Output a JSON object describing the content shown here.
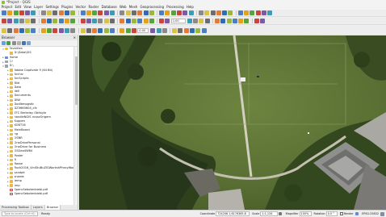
{
  "window": {
    "title": "*Project - QGIS"
  },
  "menu": [
    "Project",
    "Edit",
    "View",
    "Layer",
    "Settings",
    "Plugins",
    "Vector",
    "Raster",
    "Database",
    "Web",
    "Mesh",
    "Geoprocessing",
    "Processing",
    "Help"
  ],
  "browser": {
    "title": "Browser",
    "tree": [
      {
        "label": "Favorites",
        "icon": "star",
        "depth": 0,
        "arrow": "▾"
      },
      {
        "label": "D:\\Data\\GIS",
        "icon": "folder",
        "depth": 1,
        "arrow": ""
      },
      {
        "label": "Home",
        "icon": "home",
        "depth": 0,
        "arrow": "▸"
      },
      {
        "label": "C:\\",
        "icon": "drive",
        "depth": 0,
        "arrow": "▸"
      },
      {
        "label": "D:\\",
        "icon": "drive",
        "depth": 0,
        "arrow": "▾"
      },
      {
        "label": "Adobe Captivate 9 (64 Bit)",
        "icon": "folder",
        "depth": 1,
        "arrow": "▸"
      },
      {
        "label": "Archiv",
        "icon": "folder",
        "depth": 1,
        "arrow": "▸"
      },
      {
        "label": "ArcScripts",
        "icon": "folder",
        "depth": 1,
        "arrow": "▸"
      },
      {
        "label": "Bild",
        "icon": "folder",
        "depth": 1,
        "arrow": "▸"
      },
      {
        "label": "Data",
        "icon": "folder",
        "depth": 1,
        "arrow": "▸"
      },
      {
        "label": "dell",
        "icon": "folder",
        "depth": 1,
        "arrow": "▸"
      },
      {
        "label": "Documents",
        "icon": "folder",
        "depth": 1,
        "arrow": "▸"
      },
      {
        "label": "DNA",
        "icon": "folder",
        "depth": 1,
        "arrow": "▸"
      },
      {
        "label": "Dodlbmpgstb",
        "icon": "folder",
        "depth": 1,
        "arrow": "▸"
      },
      {
        "label": "DZ3660604_cfz",
        "icon": "folder",
        "depth": 1,
        "arrow": "▸"
      },
      {
        "label": "ETC Berkeley Obfstyle",
        "icon": "folder",
        "depth": 1,
        "arrow": "▸"
      },
      {
        "label": "handleNGIS ncsszOrigem",
        "icon": "folder",
        "depth": 1,
        "arrow": "▸"
      },
      {
        "label": "Kuppen",
        "icon": "folder",
        "depth": 1,
        "arrow": "▸"
      },
      {
        "label": "KOBT16",
        "icon": "folder",
        "depth": 1,
        "arrow": "▸"
      },
      {
        "label": "MeinBoard",
        "icon": "folder",
        "depth": 1,
        "arrow": "▸"
      },
      {
        "label": "ng",
        "icon": "folder",
        "depth": 1,
        "arrow": "▸"
      },
      {
        "label": "OSNR",
        "icon": "folder",
        "depth": 1,
        "arrow": "▸"
      },
      {
        "label": "OneDrivePersonal",
        "icon": "folder",
        "depth": 1,
        "arrow": "▸"
      },
      {
        "label": "OneDrive for Business",
        "icon": "folder",
        "depth": 1,
        "arrow": "▸"
      },
      {
        "label": "OSGeo4W64",
        "icon": "folder",
        "depth": 1,
        "arrow": "▸"
      },
      {
        "label": "Poster",
        "icon": "folder",
        "depth": 1,
        "arrow": "▸"
      },
      {
        "label": "R",
        "icon": "folder",
        "depth": 1,
        "arrow": "▸"
      },
      {
        "label": "Rasse",
        "icon": "folder",
        "depth": 1,
        "arrow": "▸"
      },
      {
        "label": "Ruck2016_ViniStuBuZIGWorkshPhecyWorn",
        "icon": "folder",
        "depth": 1,
        "arrow": "▸"
      },
      {
        "label": "sandpit",
        "icon": "folder",
        "depth": 1,
        "arrow": "▸"
      },
      {
        "label": "snarde",
        "icon": "folder",
        "depth": 1,
        "arrow": "▸"
      },
      {
        "label": "temp",
        "icon": "folder",
        "depth": 1,
        "arrow": "▸"
      },
      {
        "label": "tmp",
        "icon": "folder",
        "depth": 1,
        "arrow": "▸"
      },
      {
        "label": "SpencSebotenbiebi.pdf",
        "icon": "pdf",
        "depth": 1,
        "arrow": ""
      },
      {
        "label": "SpencSebotenbiebi.pdf",
        "icon": "pdf",
        "depth": 1,
        "arrow": ""
      }
    ]
  },
  "bottom_tabs": [
    "Processing Toolbox",
    "Layers",
    "Browser"
  ],
  "toolbar": {
    "scale_input": "1:00",
    "field_input": "0.00"
  },
  "status": {
    "locator_placeholder": "Type to locate (Ctrl+K)",
    "ready": "Ready",
    "coordinate_label": "Coordinate",
    "coordinate_value": "724206.1,6176365.8",
    "scale_label": "Scale",
    "scale_value": "1:1,134",
    "magnifier_label": "Magnifier",
    "magnifier_value": "100%",
    "rotation_label": "Rotation",
    "rotation_value": "0.0 °",
    "render_label": "Render",
    "crs": "EPSG:25832"
  },
  "colors": {
    "grass": "#5d7336",
    "trees": "#2c3d1b",
    "path": "#c9c6b8",
    "building": "#9e9e9c"
  }
}
